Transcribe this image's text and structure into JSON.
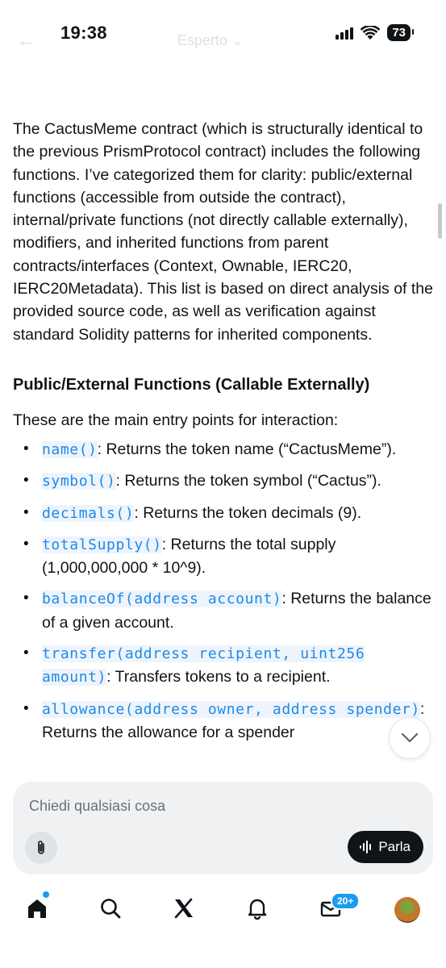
{
  "status_bar": {
    "time": "19:38",
    "battery": "73"
  },
  "faded_header": {
    "back": "←",
    "title": "Esperto ⌄"
  },
  "content": {
    "paragraph": "The CactusMeme contract (which is structurally identical to the previous PrismProtocol contract) includes the following functions. I’ve categorized them for clarity: public/external functions (accessible from outside the contract), internal/private functions (not directly callable externally), modifiers, and inherited functions from parent contracts/interfaces (Context, Ownable, IERC20, IERC20Metadata). This list is based on direct analysis of the provided source code, as well as verification against standard Solidity patterns for inherited components.",
    "section_title": "Public/External Functions (Callable Externally)",
    "intro": "These are the main entry points for interaction:",
    "functions": [
      {
        "code": "name()",
        "desc": ": Returns the token name (“CactusMeme”)."
      },
      {
        "code": "symbol()",
        "desc": ": Returns the token symbol (“Cactus”)."
      },
      {
        "code": "decimals()",
        "desc": ": Returns the token decimals (9)."
      },
      {
        "code": "totalSupply()",
        "desc": ": Returns the total supply (1,000,000,000 * 10^9)."
      },
      {
        "code": "balanceOf(address account)",
        "desc": ": Returns the balance of a given account."
      },
      {
        "code": "transfer(address recipient, uint256 amount)",
        "desc": ": Transfers tokens to a recipient."
      },
      {
        "code": "allowance(address owner, address spender)",
        "desc": ": Returns the allowance for a spender"
      }
    ]
  },
  "composer": {
    "placeholder": "Chiedi qualsiasi cosa",
    "talk_label": "Parla"
  },
  "tabbar": {
    "messages_badge": "20+"
  },
  "colors": {
    "accent": "#1d9bf0",
    "code_text": "#1d8ae8",
    "code_bg": "#eef4fb",
    "dark": "#0f1419"
  }
}
